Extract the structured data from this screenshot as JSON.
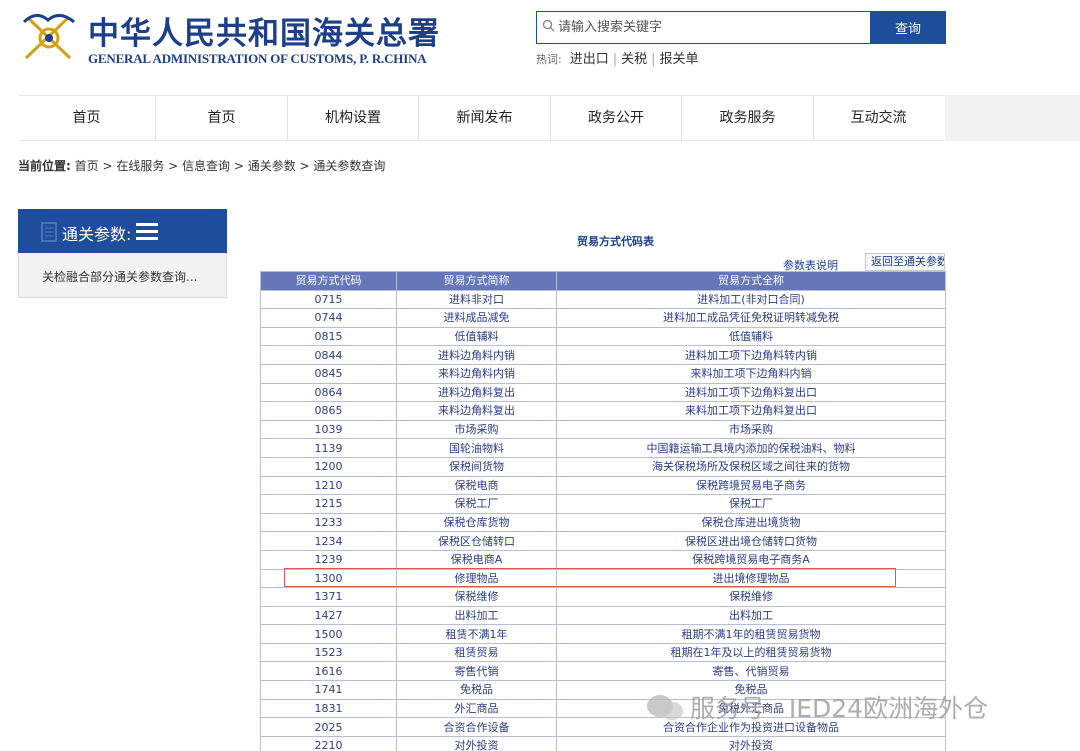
{
  "header": {
    "title_cn": "中华人民共和国海关总署",
    "title_en": "GENERAL ADMINISTRATION OF CUSTOMS, P. R.CHINA",
    "search": {
      "placeholder": "请输入搜索关键字",
      "button": "查询"
    },
    "hot": {
      "label": "热词:",
      "items": [
        "进出口",
        "关税",
        "报关单"
      ]
    }
  },
  "nav": {
    "items": [
      "首页",
      "首页",
      "机构设置",
      "新闻发布",
      "政务公开",
      "政务服务",
      "互动交流"
    ]
  },
  "breadcrumb": {
    "label": "当前位置:",
    "path": "首页 > 在线服务 > 信息查询 > 通关参数 > 通关参数查询"
  },
  "sidebar": {
    "title": "通关参数:",
    "link": "关检融合部分通关参数查询..."
  },
  "table": {
    "title": "贸易方式代码表",
    "explain": "参数表说明",
    "back": "返回至通关参数",
    "headers": [
      "贸易方式代码",
      "贸易方式简称",
      "贸易方式全称"
    ],
    "rows": [
      [
        "0715",
        "进料非对口",
        "进料加工(非对口合同)"
      ],
      [
        "0744",
        "进料成品减免",
        "进料加工成品凭征免税证明转减免税"
      ],
      [
        "0815",
        "低值辅料",
        "低值辅料"
      ],
      [
        "0844",
        "进料边角料内销",
        "进料加工项下边角料转内销"
      ],
      [
        "0845",
        "来料边角料内销",
        "来料加工项下边角料内销"
      ],
      [
        "0864",
        "进料边角料复出",
        "进料加工项下边角料复出口"
      ],
      [
        "0865",
        "来料边角料复出",
        "来料加工项下边角料复出口"
      ],
      [
        "1039",
        "市场采购",
        "市场采购"
      ],
      [
        "1139",
        "国轮油物料",
        "中国籍运输工具境内添加的保税油料、物料"
      ],
      [
        "1200",
        "保税间货物",
        "海关保税场所及保税区域之间往来的货物"
      ],
      [
        "1210",
        "保税电商",
        "保税跨境贸易电子商务"
      ],
      [
        "1215",
        "保税工厂",
        "保税工厂"
      ],
      [
        "1233",
        "保税仓库货物",
        "保税仓库进出境货物"
      ],
      [
        "1234",
        "保税区仓储转口",
        "保税区进出境仓储转口货物"
      ],
      [
        "1239",
        "保税电商A",
        "保税跨境贸易电子商务A"
      ],
      [
        "1300",
        "修理物品",
        "进出境修理物品"
      ],
      [
        "1371",
        "保税维修",
        "保税维修"
      ],
      [
        "1427",
        "出料加工",
        "出料加工"
      ],
      [
        "1500",
        "租赁不满1年",
        "租期不满1年的租赁贸易货物"
      ],
      [
        "1523",
        "租赁贸易",
        "租期在1年及以上的租赁贸易货物"
      ],
      [
        "1616",
        "寄售代销",
        "寄售、代销贸易"
      ],
      [
        "1741",
        "免税品",
        "免税品"
      ],
      [
        "1831",
        "外汇商品",
        "免税外汇商品"
      ],
      [
        "2025",
        "合资合作设备",
        "合资合作企业作为投资进口设备物品"
      ],
      [
        "2210",
        "对外投资",
        "对外投资"
      ]
    ]
  },
  "watermark": "服务号 · IED24欧洲海外仓",
  "colors": {
    "brand": "#1d4d9b",
    "table_header": "#6577b8",
    "highlight": "#e05555"
  }
}
